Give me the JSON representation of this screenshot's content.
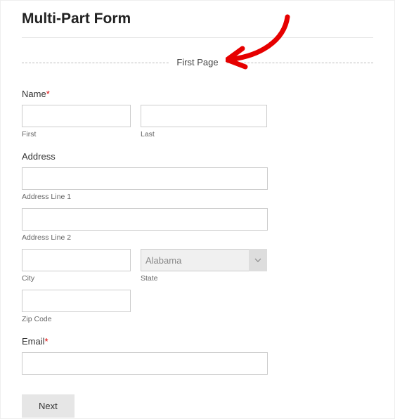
{
  "title": "Multi-Part Form",
  "page_divider_label": "First Page",
  "name": {
    "label": "Name",
    "required_mark": "*",
    "first_sub": "First",
    "last_sub": "Last"
  },
  "address": {
    "label": "Address",
    "line1_sub": "Address Line 1",
    "line2_sub": "Address Line 2",
    "city_sub": "City",
    "state_sub": "State",
    "state_selected": "Alabama",
    "zip_sub": "Zip Code"
  },
  "email": {
    "label": "Email",
    "required_mark": "*"
  },
  "next_button": "Next"
}
